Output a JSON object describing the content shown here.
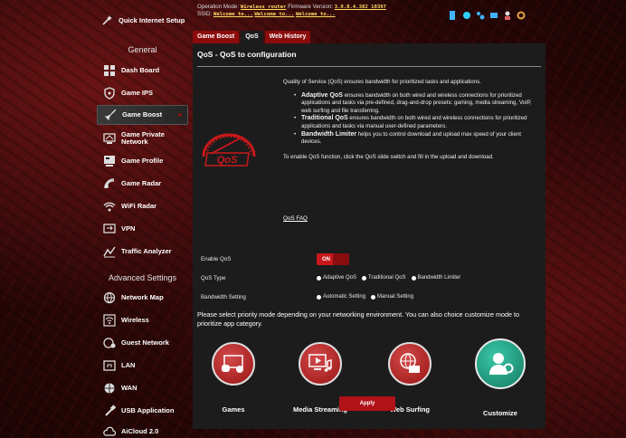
{
  "sidebar": {
    "quick_setup": "Quick Internet Setup",
    "general_heading": "General",
    "items": [
      {
        "label": "Dash Board"
      },
      {
        "label": "Game IPS"
      },
      {
        "label": "Game Boost"
      },
      {
        "label": "Game Private Network"
      },
      {
        "label": "Game Profile"
      },
      {
        "label": "Game Radar"
      },
      {
        "label": "WiFi Radar"
      },
      {
        "label": "VPN"
      },
      {
        "label": "Traffic Analyzer"
      }
    ],
    "advanced_heading": "Advanced Settings",
    "advanced_items": [
      {
        "label": "Network Map"
      },
      {
        "label": "Wireless"
      },
      {
        "label": "Guest Network"
      },
      {
        "label": "LAN"
      },
      {
        "label": "WAN"
      },
      {
        "label": "USB Application"
      },
      {
        "label": "AiCloud 2.0"
      }
    ]
  },
  "header": {
    "op_mode_label": "Operation Mode:",
    "op_mode_value": "Wireless router",
    "firmware_label": "Firmware Version:",
    "firmware_value": "3.0.0.4.382_10397",
    "ssid_label": "SSID:",
    "ssid_1": "Welcome to...",
    "ssid_2": "Welcome to...",
    "ssid_3": "Welcome to..."
  },
  "tabs": [
    {
      "label": "Game Boost"
    },
    {
      "label": "QoS"
    },
    {
      "label": "Web History"
    }
  ],
  "main": {
    "title": "QoS - QoS to configuration",
    "intro": "Quality of Service (QoS) ensures bandwidth for prioritized tasks and applications.",
    "bullets": [
      {
        "term": "Adaptive QoS",
        "text": " ensures bandwidth on both wired and wireless connections for prioritized applications and tasks via pre-defined, drag-and-drop presets: gaming, media streaming, VoIP, web surfing and file transferring."
      },
      {
        "term": "Traditional QoS",
        "text": " ensures bandwidth on both wired and wireless connections for prioritized applications and tasks via manual user-defined parameters."
      },
      {
        "term": "Bandwidth Limiter",
        "text": " helps you to control download and upload max speed of your client devices."
      }
    ],
    "enable_note": "To enable QoS function, click the QoS slide switch and fill in the upload and download.",
    "faq_link": "QoS FAQ",
    "enable_label": "Enable QoS",
    "toggle_state": "ON",
    "type_label": "QoS Type",
    "type_options": [
      "Adaptive QoS",
      "Traditional QoS",
      "Bandwidth Limiter"
    ],
    "bandwidth_label": "Bandwidth Setting",
    "bandwidth_options": [
      "Automatic Setting",
      "Manual Setting"
    ],
    "priority_text": "Please select priority mode depending on your networking environment. You can also choice customize mode to prioritize app category.",
    "modes": [
      {
        "label": "Games"
      },
      {
        "label": "Media Streaming"
      },
      {
        "label": "Web Surfing"
      },
      {
        "label": "Customize"
      }
    ],
    "apply_label": "Apply"
  },
  "colors": {
    "accent": "#c9181b",
    "panel": "#1c1c1c",
    "customize": "#2aa88a"
  }
}
